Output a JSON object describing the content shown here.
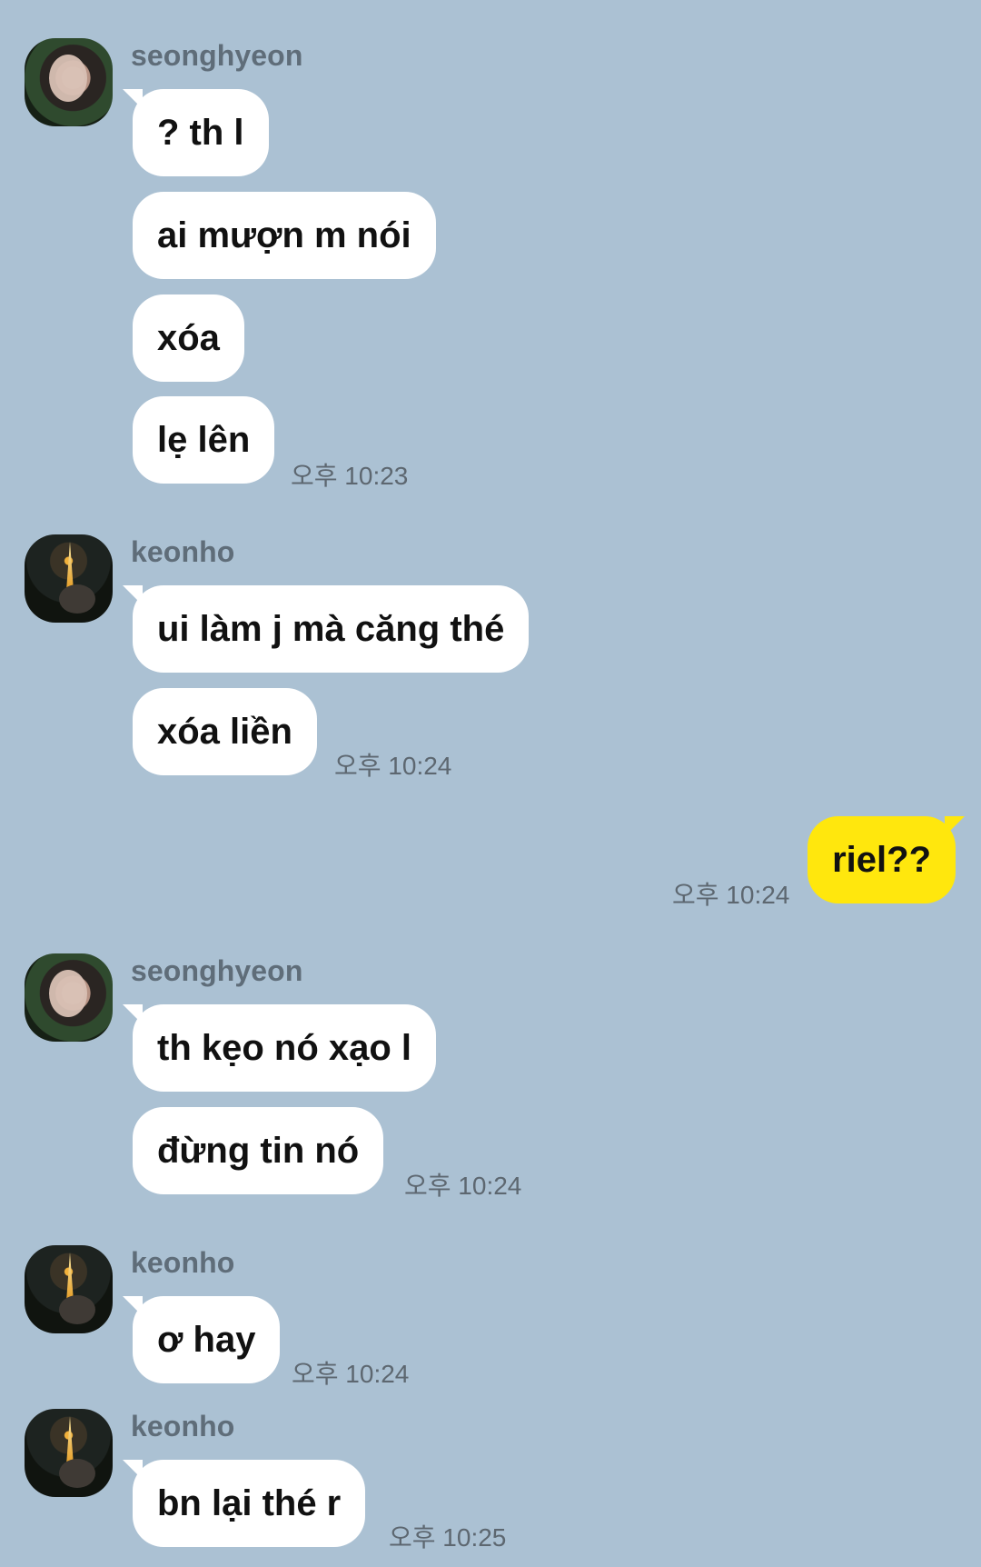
{
  "messages": {
    "g1": {
      "sender": "seonghyeon",
      "texts": [
        "? th l",
        "ai mượn m nói",
        "xóa",
        "lẹ lên"
      ],
      "time": "오후 10:23"
    },
    "g2": {
      "sender": "keonho",
      "texts": [
        "ui làm j mà căng thé",
        "xóa liền"
      ],
      "time": "오후 10:24"
    },
    "g3": {
      "texts": [
        "riel??"
      ],
      "time": "오후 10:24"
    },
    "g4": {
      "sender": "seonghyeon",
      "texts": [
        "th kẹo nó xạo l",
        "đừng tin nó"
      ],
      "time": "오후 10:24"
    },
    "g5": {
      "sender": "keonho",
      "texts": [
        "ơ hay"
      ],
      "time": "오후 10:24"
    },
    "g6": {
      "sender": "keonho",
      "texts": [
        "bn lại thé r"
      ],
      "time": "오후 10:25"
    }
  },
  "avatars": {
    "seonghyeon": "profile-photo",
    "keonho": "profile-photo"
  },
  "colors": {
    "background": "#abc1d3",
    "incoming_bubble": "#ffffff",
    "outgoing_bubble": "#ffe70d",
    "sender_name": "#5f6d79",
    "timestamp": "#5d6770"
  }
}
